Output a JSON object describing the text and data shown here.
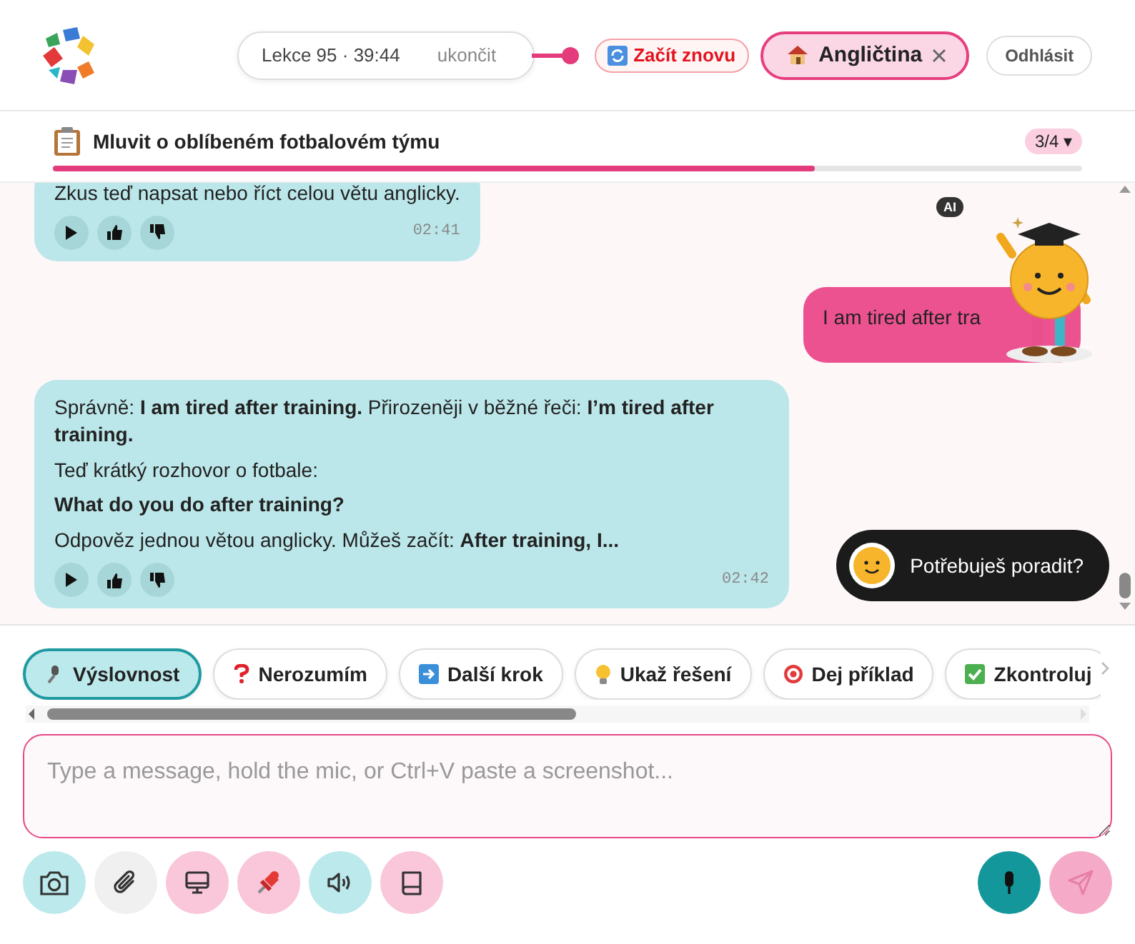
{
  "header": {
    "lesson": "Lekce 95 · 39:44",
    "end_link": "ukončit",
    "restart_button": "Začít znovu",
    "language_tab": {
      "label": "Angličtina",
      "selected": true
    },
    "logout_button": "Odhlásit"
  },
  "task": {
    "title": "Mluvit o oblíbeném fotbalovém týmu",
    "level": 0.74,
    "step": "3/4 ▾"
  },
  "messages": [
    {
      "kind": "assistant",
      "paragraphs": [
        "Zkus teď napsat nebo říct celou větu anglicky."
      ],
      "time": "02:41"
    },
    {
      "kind": "user",
      "paragraphs": [
        "I am tired after tra"
      ]
    },
    {
      "kind": "assistant",
      "paragraphs": [
        "Správně: **I am tired after training.** Přirozeněji v běžné řeči: **I’m tired after training.**",
        "Teď krátký rozhovor o fotbale:",
        "**What do you do after training?**",
        "Odpověz jednou větou anglicky. Můžeš začít: **After training, I...**"
      ],
      "time": "02:42"
    }
  ],
  "ai_badge": "AI",
  "help_bubble": "Potřebuješ poradit?",
  "chips": [
    {
      "kind": "mic",
      "label": "Výslovnost",
      "selected": true
    },
    {
      "kind": "question",
      "label": "Nerozumím",
      "selected": false
    },
    {
      "kind": "next",
      "label": "Další krok",
      "selected": false
    },
    {
      "kind": "bulb",
      "label": "Ukaž řešení",
      "selected": false
    },
    {
      "kind": "target",
      "label": "Dej příklad",
      "selected": false
    },
    {
      "kind": "check",
      "label": "Zkontroluj",
      "selected": false
    }
  ],
  "input": {
    "placeholder": "Type a message, hold the mic, or Ctrl+V paste a screenshot..."
  },
  "tools": [
    {
      "kind": "camera",
      "color": "#bce9ec"
    },
    {
      "kind": "clip",
      "color": "#f0f0f0"
    },
    {
      "kind": "screen",
      "color": "#f9c6da"
    },
    {
      "kind": "pin",
      "color": "#f9c6da"
    },
    {
      "kind": "speaker",
      "color": "#bce9ec"
    },
    {
      "kind": "book",
      "color": "#f9c6da"
    }
  ]
}
